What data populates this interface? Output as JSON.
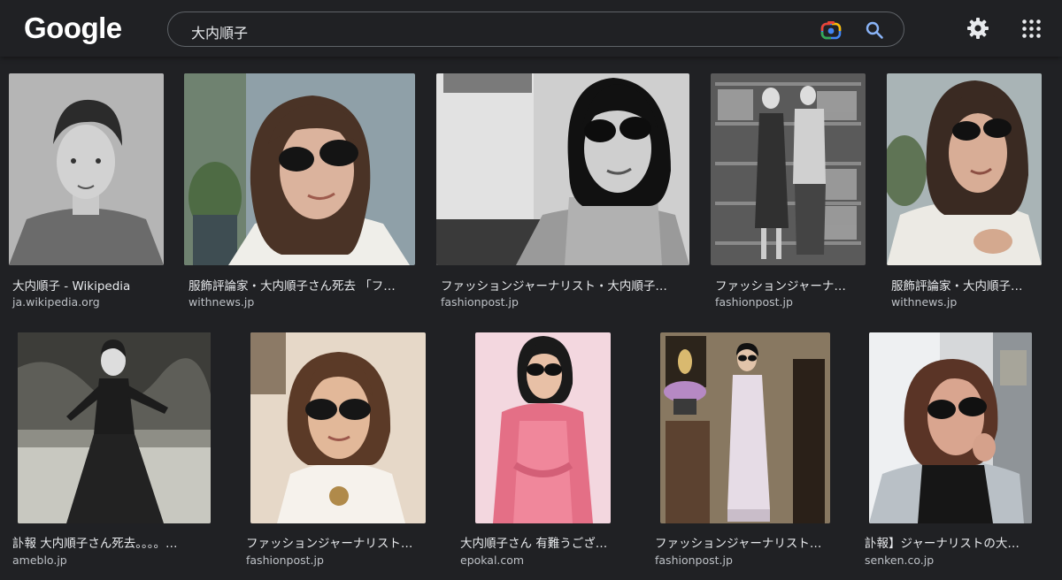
{
  "app": {
    "logo_text": "Google"
  },
  "search": {
    "query": "大内順子"
  },
  "header_icons": {
    "camera": "google-lens-camera-icon",
    "search": "search-icon",
    "settings": "gear-icon",
    "apps": "apps-grid-icon"
  },
  "colors": {
    "background": "#202124",
    "title_text": "#e8eaed",
    "source_text": "#bdc1c6",
    "search_border": "#5f6368",
    "search_icon": "#8ab4f8"
  },
  "results": [
    {
      "title": "大内順子 - Wikipedia",
      "source": "ja.wikipedia.org",
      "image": "black-and-white portrait of woman with short hair"
    },
    {
      "title": "服飾評論家・大内順子さん死去 「フ…",
      "source": "withnews.jp",
      "image": "woman with bob hair and dark sunglasses in white turtleneck"
    },
    {
      "title": "ファッションジャーナリスト・大内順子…",
      "source": "fashionpost.jp",
      "image": "monochrome photo of woman in sunglasses and turtleneck"
    },
    {
      "title": "ファッションジャーナ…",
      "source": "fashionpost.jp",
      "image": "black-and-white photo of two women in front of bookshelves"
    },
    {
      "title": "服飾評論家・大内順子…",
      "source": "withnews.jp",
      "image": "woman in sunglasses with hands clasped"
    },
    {
      "title": "訃報 大内順子さん死去。。。。…",
      "source": "ameblo.jp",
      "image": "vintage photo of woman in dark dress outdoors"
    },
    {
      "title": "ファッションジャーナリスト…",
      "source": "fashionpost.jp",
      "image": "woman with sunglasses and pendant necklace"
    },
    {
      "title": "大内順子さん 有難うござ…",
      "source": "epokal.com",
      "image": "woman in pink outfit with sunglasses"
    },
    {
      "title": "ファッションジャーナリスト…",
      "source": "fashionpost.jp",
      "image": "woman in pale kimono beside flowers"
    },
    {
      "title": "訃報】ジャーナリストの大…",
      "source": "senken.co.jp",
      "image": "woman with sunglasses hand at chin"
    }
  ]
}
